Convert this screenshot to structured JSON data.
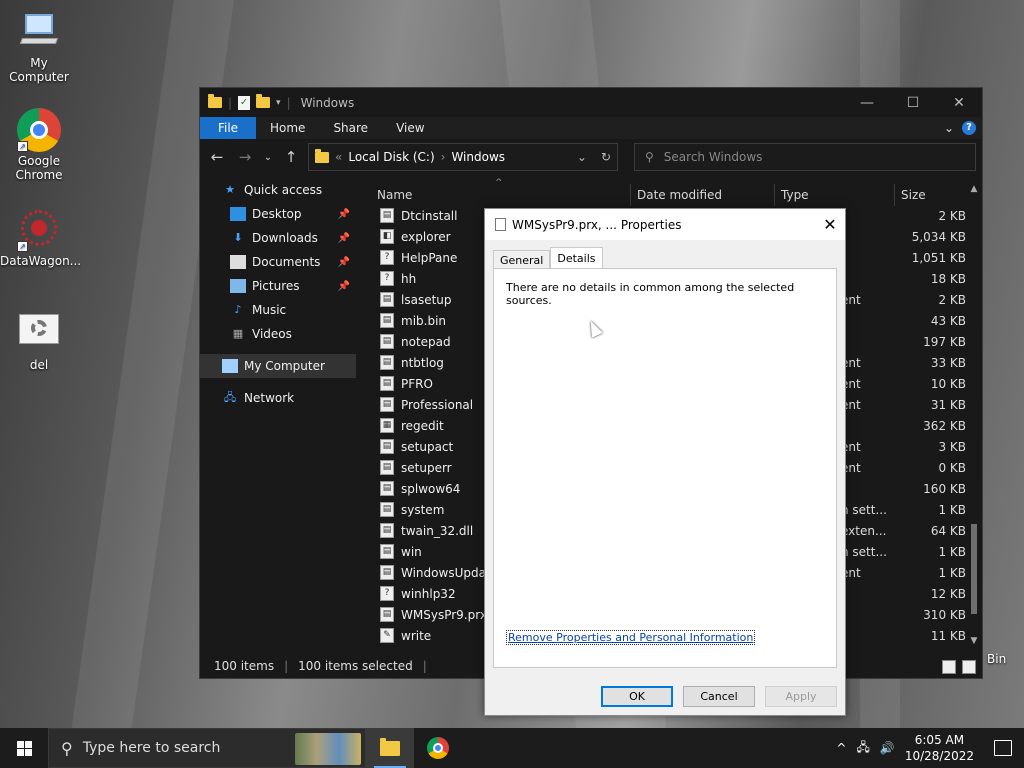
{
  "desktop": {
    "icons": [
      {
        "label": "My Computer"
      },
      {
        "label": "Google Chrome"
      },
      {
        "label": "DataWagon..."
      },
      {
        "label": "del"
      }
    ],
    "recycle_partial": "Bin"
  },
  "explorer": {
    "title": "Windows",
    "ribbon_tabs": [
      "File",
      "Home",
      "Share",
      "View"
    ],
    "address": {
      "root": "Local Disk (C:)",
      "folder": "Windows"
    },
    "search_placeholder": "Search Windows",
    "nav": {
      "quick_access": "Quick access",
      "items": [
        "Desktop",
        "Downloads",
        "Documents",
        "Pictures",
        "Music",
        "Videos"
      ],
      "my_computer": "My Computer",
      "network": "Network"
    },
    "columns": {
      "name": "Name",
      "date": "Date modified",
      "type": "Type",
      "size": "Size"
    },
    "rows": [
      {
        "name": "Dtcinstall",
        "type": "",
        "size": "2 KB"
      },
      {
        "name": "explorer",
        "type": "",
        "size": "5,034 KB"
      },
      {
        "name": "HelpPane",
        "type": "",
        "size": "1,051 KB"
      },
      {
        "name": "hh",
        "type": "",
        "size": "18 KB"
      },
      {
        "name": "lsasetup",
        "type": "ent",
        "size": "2 KB"
      },
      {
        "name": "mib.bin",
        "type": "",
        "size": "43 KB"
      },
      {
        "name": "notepad",
        "type": "",
        "size": "197 KB"
      },
      {
        "name": "ntbtlog",
        "type": "ent",
        "size": "33 KB"
      },
      {
        "name": "PFRO",
        "type": "ent",
        "size": "10 KB"
      },
      {
        "name": "Professional",
        "type": "ent",
        "size": "31 KB"
      },
      {
        "name": "regedit",
        "type": "",
        "size": "362 KB"
      },
      {
        "name": "setupact",
        "type": "ent",
        "size": "3 KB"
      },
      {
        "name": "setuperr",
        "type": "ent",
        "size": "0 KB"
      },
      {
        "name": "splwow64",
        "type": "",
        "size": "160 KB"
      },
      {
        "name": "system",
        "type": "n sett...",
        "size": "1 KB"
      },
      {
        "name": "twain_32.dll",
        "type": "exten...",
        "size": "64 KB"
      },
      {
        "name": "win",
        "type": "n sett...",
        "size": "1 KB"
      },
      {
        "name": "WindowsUpdate",
        "type": "ent",
        "size": "1 KB"
      },
      {
        "name": "winhlp32",
        "type": "",
        "size": "12 KB"
      },
      {
        "name": "WMSysPr9.prx",
        "type": "",
        "size": "310 KB"
      },
      {
        "name": "write",
        "type": "",
        "size": "11 KB"
      }
    ],
    "status": {
      "count": "100 items",
      "selected": "100 items selected"
    }
  },
  "dialog": {
    "title": "WMSysPr9.prx, ... Properties",
    "tabs": [
      "General",
      "Details"
    ],
    "message": "There are no details in common among the selected sources.",
    "link": "Remove Properties and Personal Information",
    "buttons": {
      "ok": "OK",
      "cancel": "Cancel",
      "apply": "Apply"
    }
  },
  "taskbar": {
    "search_placeholder": "Type here to search",
    "time": "6:05 AM",
    "date": "10/28/2022"
  },
  "colors": {
    "accent": "#1a6fc9",
    "folder": "#f3c843"
  }
}
